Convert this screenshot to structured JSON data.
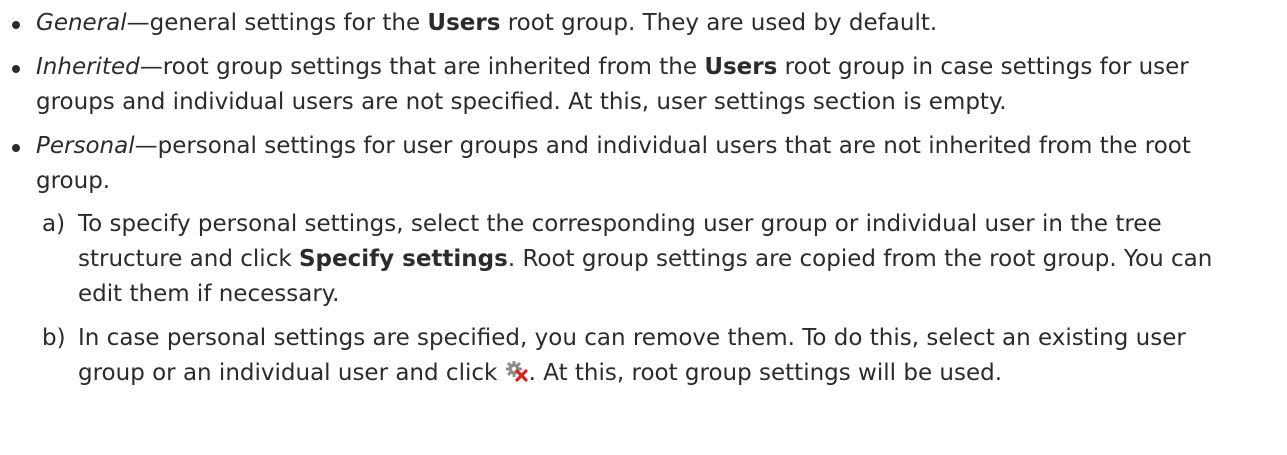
{
  "items": [
    {
      "term": "General",
      "dash": "—",
      "text_a": "general settings for the ",
      "bold": "Users",
      "text_b": " root group. They are used by default."
    },
    {
      "term": "Inherited",
      "dash": "—",
      "text_a": "root group settings that are inherited from the ",
      "bold": "Users",
      "text_b": " root group in case settings for user groups and individual users are not specified. At this, user settings section is empty."
    },
    {
      "term": "Personal",
      "dash": "—",
      "text_a": "personal settings for user groups and individual users that are not inherited from the root group."
    }
  ],
  "steps": [
    {
      "marker": "a)",
      "text_a": "To specify personal settings, select the corresponding user group or individual user in the tree structure and click ",
      "bold": "Specify settings",
      "text_b": ". Root group settings are copied from the root group. You can edit them if necessary."
    },
    {
      "marker": "b)",
      "text_a": "In case personal settings are specified, you can remove them. To do this, select an exist­ing user group or an individual user and click ",
      "icon": "remove-settings-gear-icon",
      "text_b": ". At this, root group settings will be used."
    }
  ],
  "colors": {
    "text": "#2b2b2b",
    "icon_gear": "#8c8c8c",
    "icon_x": "#d9231f"
  }
}
